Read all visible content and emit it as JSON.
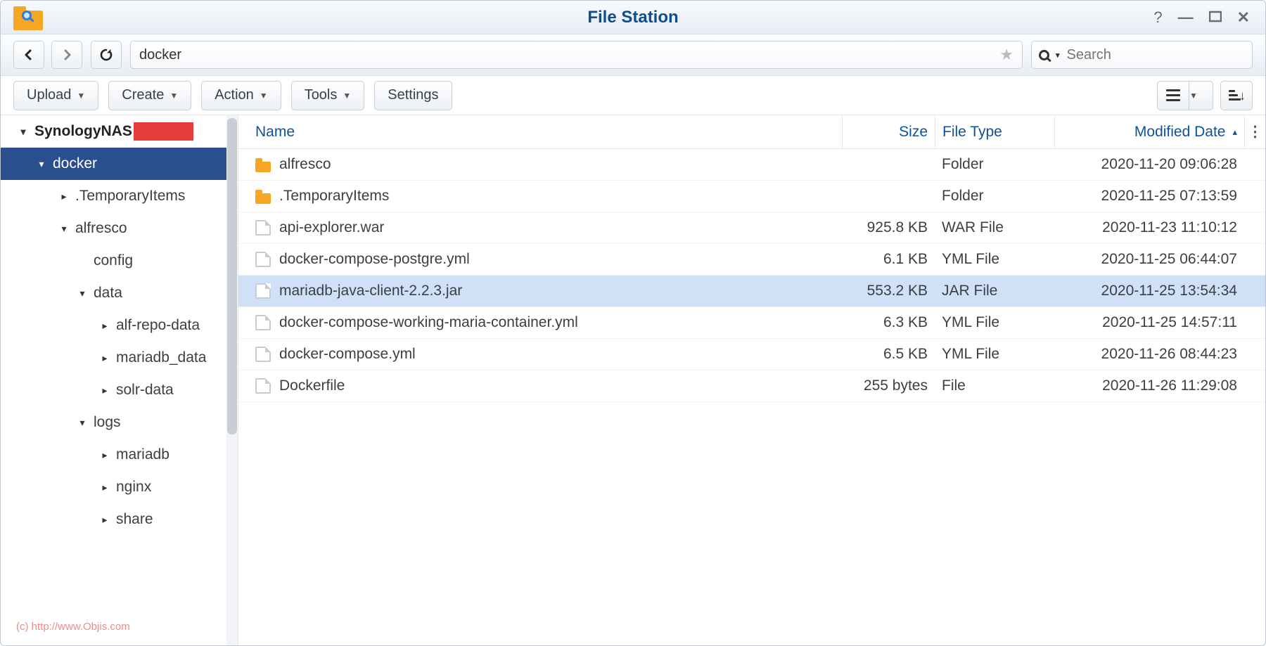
{
  "titlebar": {
    "title": "File Station"
  },
  "path": {
    "value": "docker"
  },
  "search": {
    "placeholder": "Search"
  },
  "toolbar": {
    "upload": "Upload",
    "create": "Create",
    "action": "Action",
    "tools": "Tools",
    "settings": "Settings"
  },
  "tree": {
    "root": "SynologyNAS",
    "items": [
      {
        "label": "docker",
        "selected": true,
        "children": [
          {
            "label": ".TemporaryItems"
          },
          {
            "label": "alfresco",
            "children": [
              {
                "label": "config"
              },
              {
                "label": "data",
                "children": [
                  {
                    "label": "alf-repo-data"
                  },
                  {
                    "label": "mariadb_data"
                  },
                  {
                    "label": "solr-data"
                  }
                ]
              },
              {
                "label": "logs",
                "children": [
                  {
                    "label": "mariadb"
                  },
                  {
                    "label": "nginx"
                  },
                  {
                    "label": "share"
                  }
                ]
              }
            ]
          }
        ]
      }
    ]
  },
  "columns": {
    "name": "Name",
    "size": "Size",
    "type": "File Type",
    "modified": "Modified Date"
  },
  "rows": [
    {
      "icon": "folder",
      "name": "alfresco",
      "size": "",
      "type": "Folder",
      "modified": "2020-11-20 09:06:28",
      "selected": false
    },
    {
      "icon": "folder",
      "name": ".TemporaryItems",
      "size": "",
      "type": "Folder",
      "modified": "2020-11-25 07:13:59",
      "selected": false
    },
    {
      "icon": "file",
      "name": "api-explorer.war",
      "size": "925.8 KB",
      "type": "WAR File",
      "modified": "2020-11-23 11:10:12",
      "selected": false
    },
    {
      "icon": "file",
      "name": "docker-compose-postgre.yml",
      "size": "6.1 KB",
      "type": "YML File",
      "modified": "2020-11-25 06:44:07",
      "selected": false
    },
    {
      "icon": "file",
      "name": "mariadb-java-client-2.2.3.jar",
      "size": "553.2 KB",
      "type": "JAR File",
      "modified": "2020-11-25 13:54:34",
      "selected": true
    },
    {
      "icon": "file",
      "name": "docker-compose-working-maria-container.yml",
      "size": "6.3 KB",
      "type": "YML File",
      "modified": "2020-11-25 14:57:11",
      "selected": false
    },
    {
      "icon": "file",
      "name": "docker-compose.yml",
      "size": "6.5 KB",
      "type": "YML File",
      "modified": "2020-11-26 08:44:23",
      "selected": false
    },
    {
      "icon": "file",
      "name": "Dockerfile",
      "size": "255 bytes",
      "type": "File",
      "modified": "2020-11-26 11:29:08",
      "selected": false
    }
  ],
  "footer": {
    "copyright": "(c) http://www.Objis.com"
  }
}
